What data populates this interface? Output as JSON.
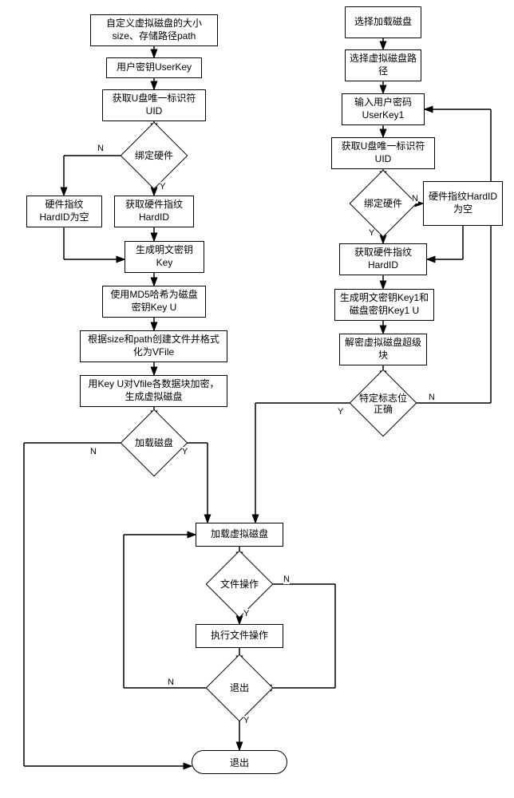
{
  "left": {
    "n1": "自定义虚拟磁盘的大小size、存储路径path",
    "n2": "用户密钥UserKey",
    "n3": "获取U盘唯一标识符UID",
    "d1": "绑定硬件",
    "n4_no": "硬件指纹HardID为空",
    "n4_yes": "获取硬件指纹HardID",
    "n5": "生成明文密钥Key",
    "n6": "使用MD5哈希为磁盘密钥Key U",
    "n7": "根据size和path创建文件并格式化为VFile",
    "n8": "用Key U对Vfile各数据块加密，生成虚拟磁盘",
    "d2": "加载磁盘"
  },
  "right": {
    "n1": "选择加载磁盘",
    "n2": "选择虚拟磁盘路径",
    "n3": "输入用户密码UserKey1",
    "n4": "获取U盘唯一标识符UID",
    "d1": "绑定硬件",
    "n5_no": "硬件指纹HardID为空",
    "n5_yes": "获取硬件指纹HardID",
    "n6": "生成明文密钥Key1和磁盘密钥Key1 U",
    "n7": "解密虚拟磁盘超级块",
    "d2": "特定标志位正确"
  },
  "bottom": {
    "load": "加载虚拟磁盘",
    "d1": "文件操作",
    "exec": "执行文件操作",
    "d2": "退出",
    "exit": "退出"
  },
  "labels": {
    "Y": "Y",
    "N": "N"
  }
}
